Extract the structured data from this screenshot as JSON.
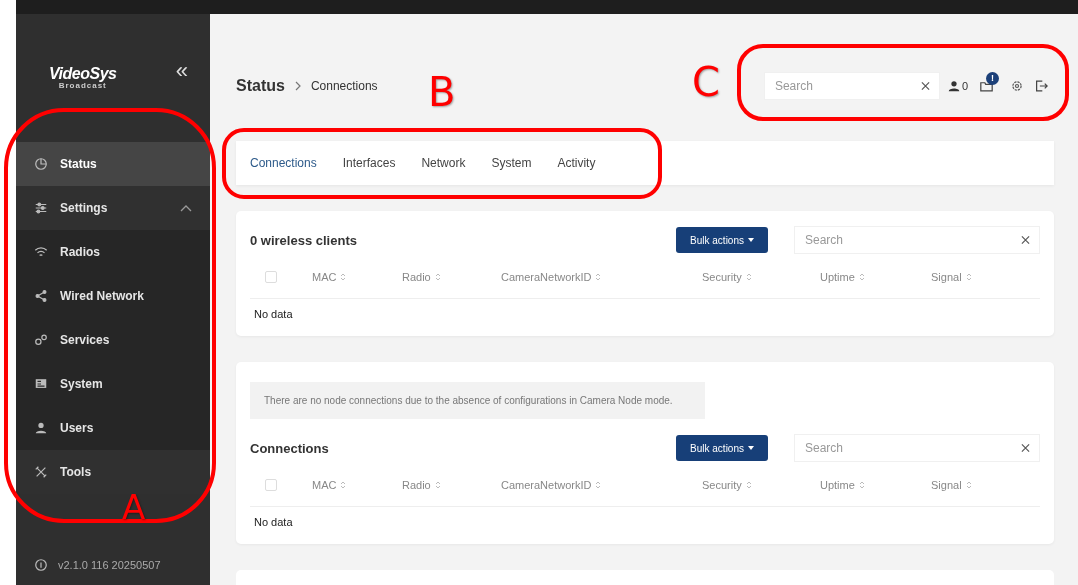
{
  "sidebar": {
    "logo": {
      "name": "VideoSys",
      "tagline": "Broadcast"
    },
    "collapse": "«",
    "items": [
      {
        "label": "Status",
        "kind": "pie",
        "selected": true
      },
      {
        "label": "Settings",
        "kind": "sliders",
        "selected": false,
        "expanded": true,
        "children": [
          {
            "label": "Radios",
            "kind": "wifi",
            "selected": false
          },
          {
            "label": "Wired Network",
            "kind": "share",
            "selected": false
          },
          {
            "label": "Services",
            "kind": "gears",
            "selected": false
          },
          {
            "label": "System",
            "kind": "monitor",
            "selected": false
          },
          {
            "label": "Users",
            "kind": "user",
            "selected": false
          }
        ]
      },
      {
        "label": "Tools",
        "kind": "tools",
        "selected": false
      }
    ],
    "version": "v2.1.0 116 20250507"
  },
  "header": {
    "breadcrumb": [
      "Status",
      "Connections"
    ],
    "search": {
      "placeholder": "Search"
    },
    "user_count": "0",
    "notification_badge": "!"
  },
  "tabs": [
    {
      "label": "Connections",
      "selected": true
    },
    {
      "label": "Interfaces",
      "selected": false
    },
    {
      "label": "Network",
      "selected": false
    },
    {
      "label": "System",
      "selected": false
    },
    {
      "label": "Activity",
      "selected": false
    }
  ],
  "panels": [
    {
      "title": "0 wireless clients",
      "bulk_button": "Bulk actions",
      "search": {
        "placeholder": "Search"
      },
      "select_all_checked": false,
      "columns": [
        "MAC",
        "Radio",
        "CameraNetworkID",
        "Security",
        "Uptime",
        "Signal"
      ],
      "empty": "No data"
    },
    {
      "notice": "There are no node connections due to the absence of configurations in Camera Node mode.",
      "title": "Connections",
      "bulk_button": "Bulk actions",
      "search": {
        "placeholder": "Search"
      },
      "select_all_checked": false,
      "columns": [
        "MAC",
        "Radio",
        "CameraNetworkID",
        "Security",
        "Uptime",
        "Signal"
      ],
      "empty": "No data"
    }
  ],
  "annotations": [
    {
      "label": "A"
    },
    {
      "label": "B"
    },
    {
      "label": "C"
    }
  ]
}
